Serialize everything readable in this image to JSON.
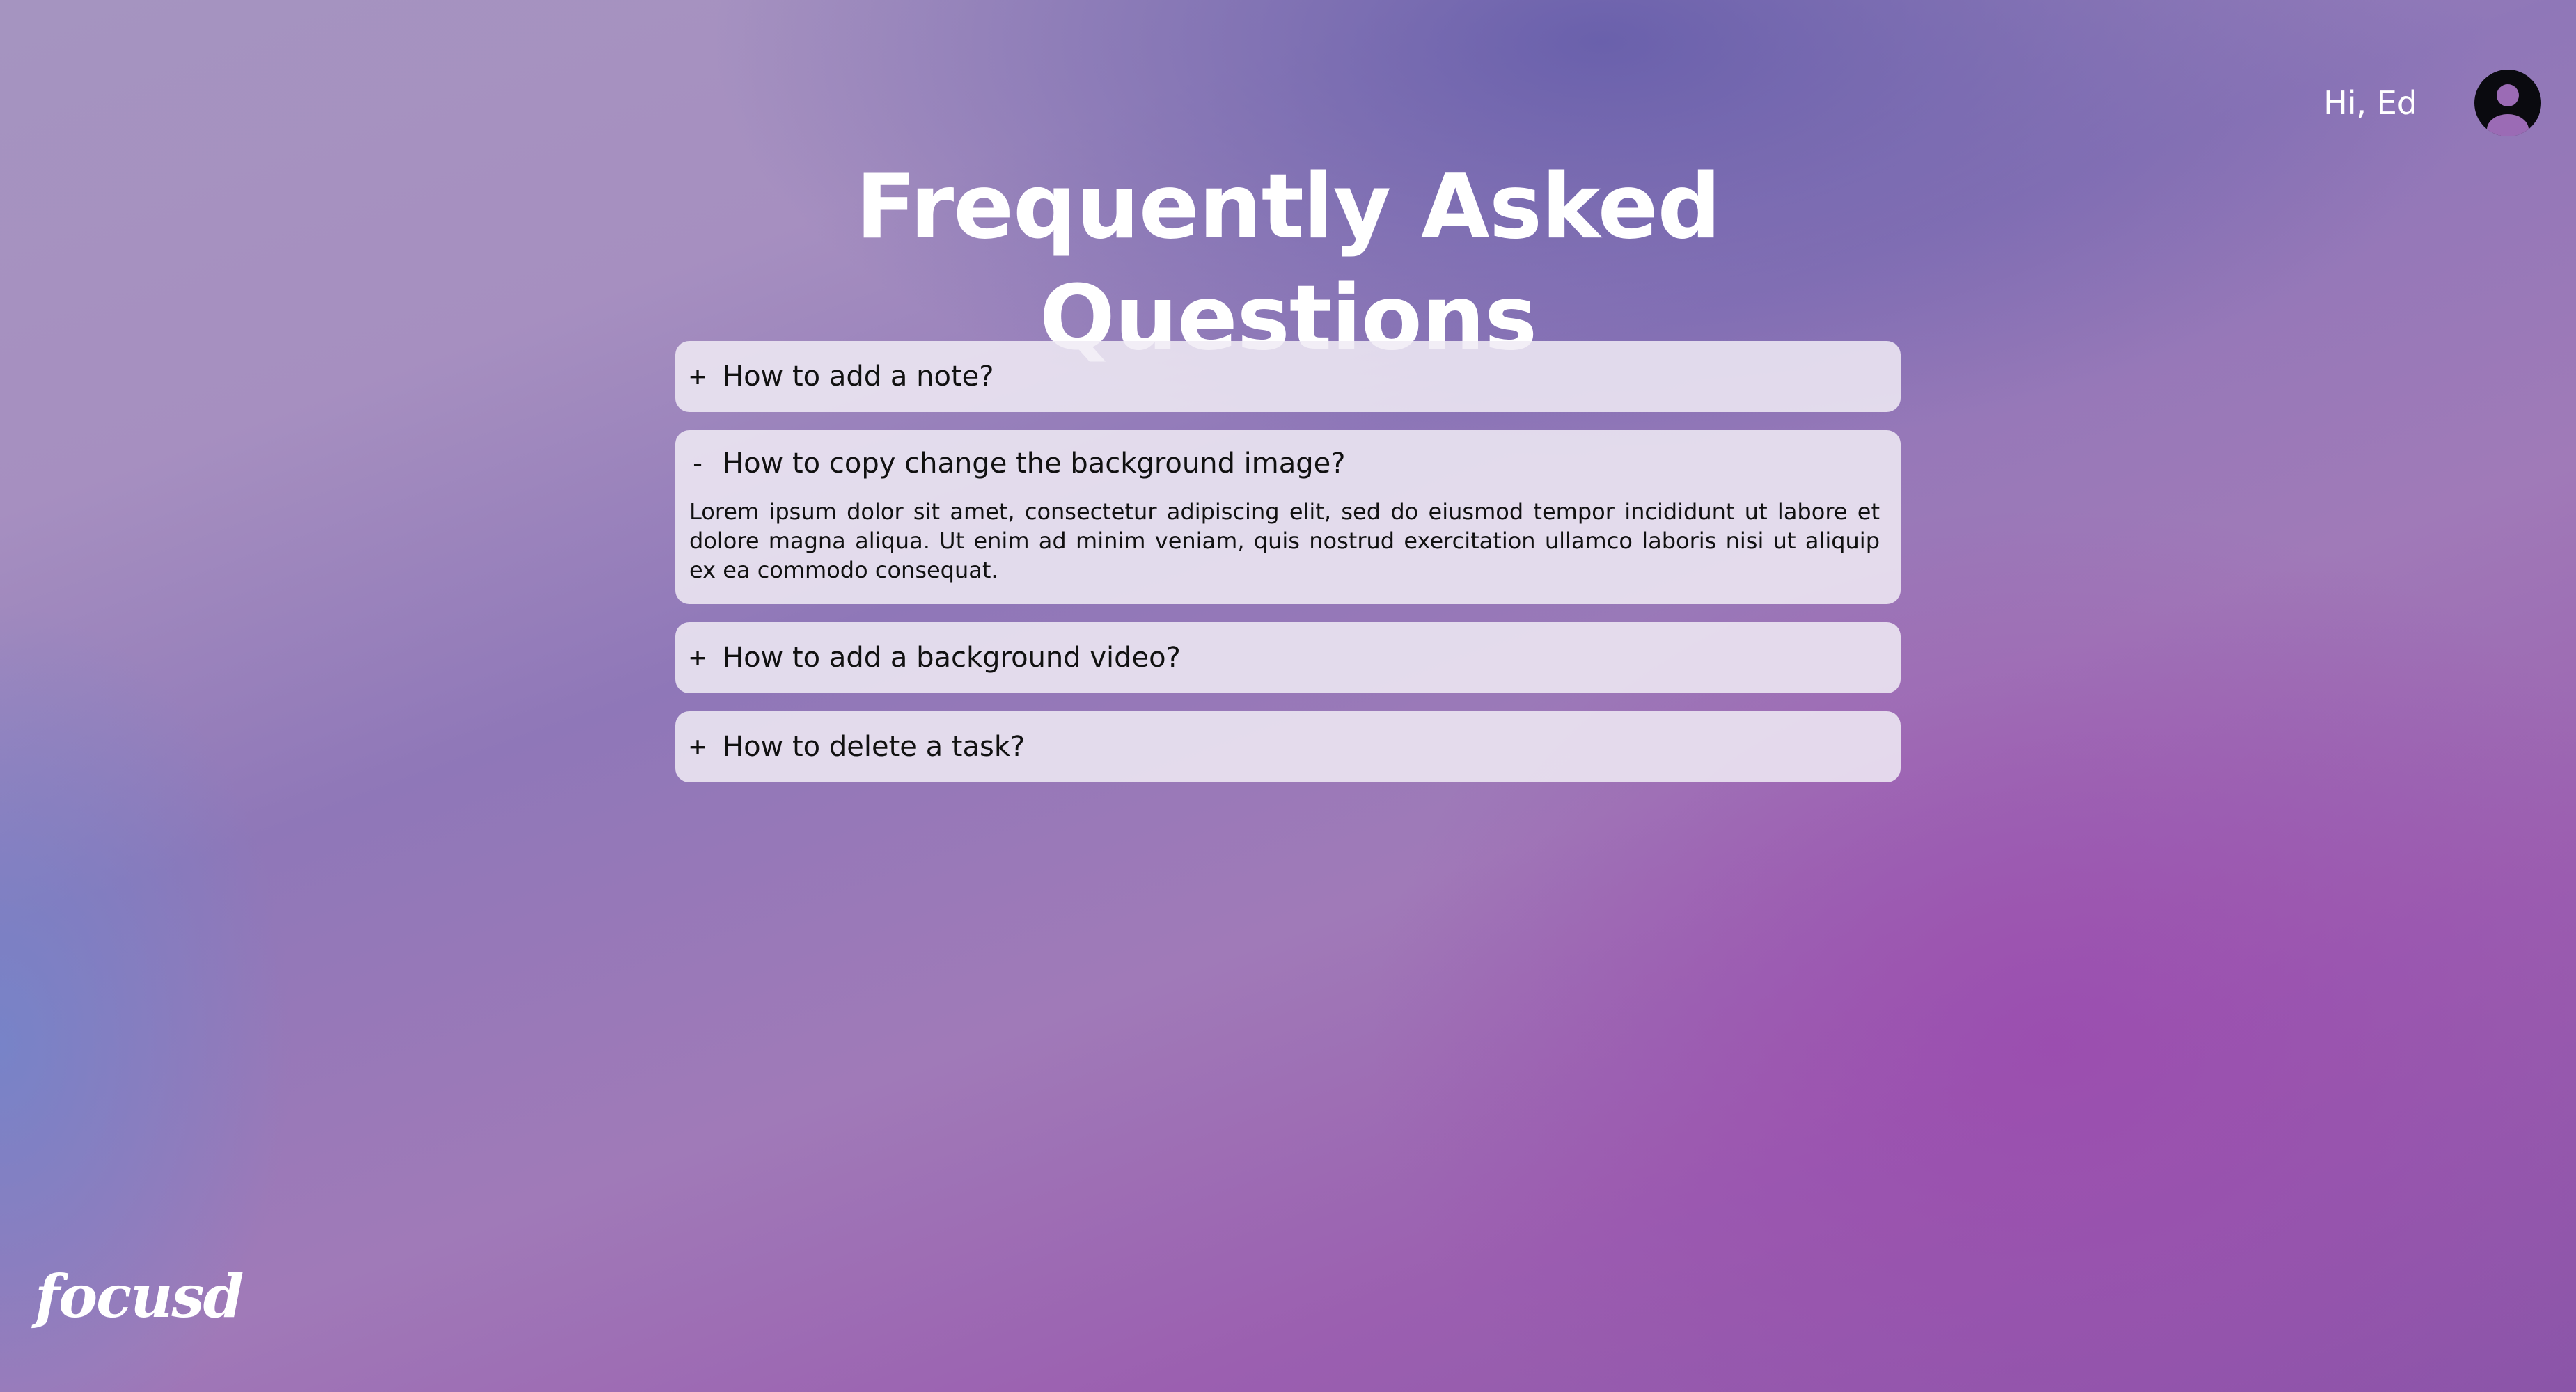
{
  "header": {
    "greeting": "Hi, Ed",
    "avatar_icon": "user-avatar-icon"
  },
  "page": {
    "title": "Frequently Asked Questions"
  },
  "faq": [
    {
      "toggle": "+",
      "question": "How to add a note?",
      "expanded": false,
      "answer": ""
    },
    {
      "toggle": "-",
      "question": "How to copy change the background image?",
      "expanded": true,
      "answer": "Lorem ipsum dolor sit amet, consectetur adipiscing elit, sed do eiusmod tempor incididunt ut labore et dolore magna aliqua. Ut enim ad minim veniam, quis nostrud exercitation ullamco laboris nisi ut aliquip ex ea commodo consequat."
    },
    {
      "toggle": "+",
      "question": "How to add a background video?",
      "expanded": false,
      "answer": ""
    },
    {
      "toggle": "+",
      "question": "How to delete a task?",
      "expanded": false,
      "answer": ""
    }
  ],
  "brand": {
    "logo_text": "focusd"
  },
  "colors": {
    "text_primary": "#ffffff",
    "card_background": "#f0ebf5",
    "card_text": "#111111",
    "avatar_background": "#0a0a0f",
    "avatar_figure": "#9b6bb5"
  }
}
